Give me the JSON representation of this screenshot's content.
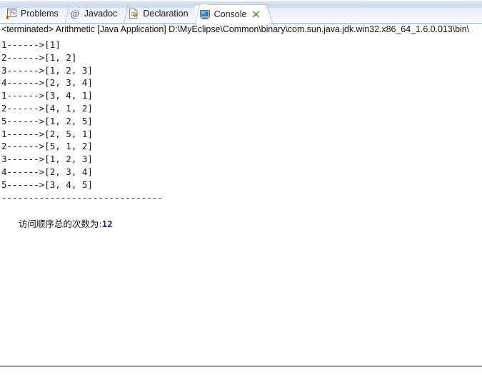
{
  "window": {
    "view_type": "eclipse-console-view"
  },
  "tabs": [
    {
      "label": "Problems",
      "icon": "problems-icon",
      "active": false,
      "closable": false
    },
    {
      "label": "Javadoc",
      "icon": "javadoc-icon",
      "active": false,
      "closable": false
    },
    {
      "label": "Declaration",
      "icon": "declaration-icon",
      "active": false,
      "closable": false
    },
    {
      "label": "Console",
      "icon": "console-icon",
      "active": true,
      "closable": true
    }
  ],
  "console": {
    "status_line": "<terminated> Arithmetic [Java Application] D:\\MyEclipse\\Common\\binary\\com.sun.java.jdk.win32.x86_64_1.6.0.013\\bin\\",
    "lines": [
      "1------>[1]",
      "2------>[1, 2]",
      "3------>[1, 2, 3]",
      "4------>[2, 3, 4]",
      "1------>[3, 4, 1]",
      "2------>[4, 1, 2]",
      "5------>[1, 2, 5]",
      "1------>[2, 5, 1]",
      "2------>[5, 1, 2]",
      "3------>[1, 2, 3]",
      "4------>[2, 3, 4]",
      "5------>[3, 4, 5]"
    ],
    "separator": "------------------------------",
    "summary_label": "访问顺序总的次数为:",
    "summary_count": "12"
  },
  "colors": {
    "tabbar_gradient_top": "#d6e2ef",
    "tabbar_gradient_bottom": "#f6f9fc",
    "active_tab_bg": "#ffffff",
    "console_bg": "#ffffff",
    "console_text": "#16161a",
    "count_text": "#1b2a6b",
    "close_icon": "#6aa84f",
    "border": "#9cb0c4"
  }
}
